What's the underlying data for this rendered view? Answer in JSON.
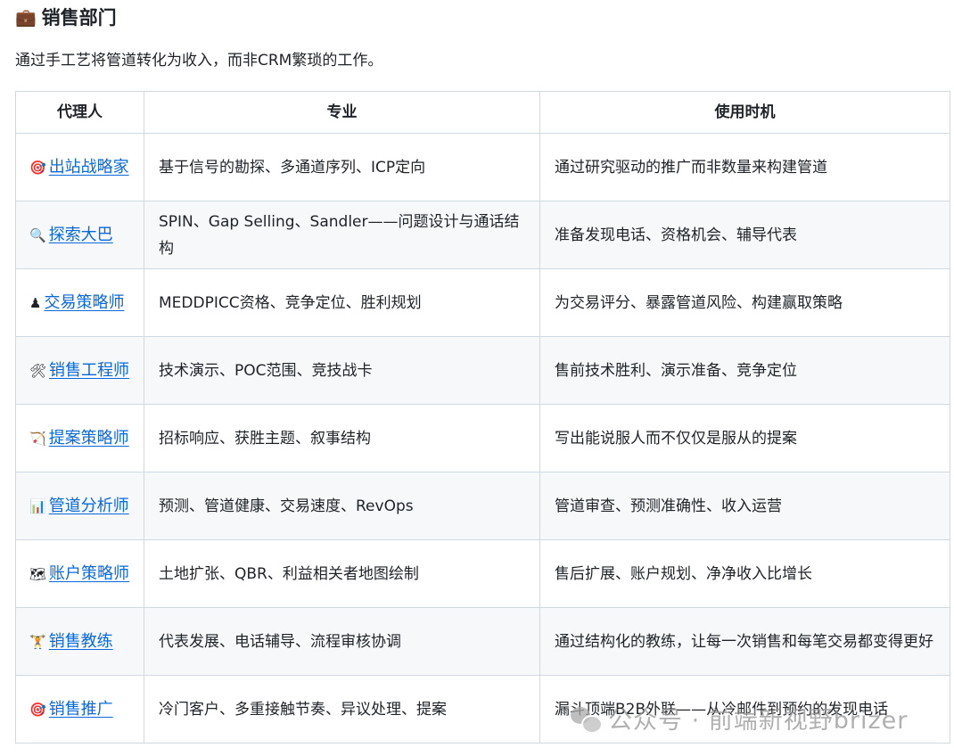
{
  "section": {
    "emoji": "💼",
    "title": "销售部门",
    "description": "通过手工艺将管道转化为收入，而非CRM繁琐的工作。"
  },
  "table": {
    "headers": [
      "代理人",
      "专业",
      "使用时机"
    ],
    "rows": [
      {
        "emoji": "🎯",
        "icon": "target-icon",
        "agent": "出站战略家",
        "expertise": "基于信号的勘探、多通道序列、ICP定向",
        "when": "通过研究驱动的推广而非数量来构建管道"
      },
      {
        "emoji": "🔍",
        "icon": "magnifier-icon",
        "agent": "探索大巴",
        "expertise": "SPIN、Gap Selling、Sandler——问题设计与通话结构",
        "when": "准备发现电话、资格机会、辅导代表"
      },
      {
        "emoji": "♟",
        "icon": "chess-pawn-icon",
        "agent": "交易策略师",
        "expertise": "MEDDPICC资格、竞争定位、胜利规划",
        "when": "为交易评分、暴露管道风险、构建赢取策略"
      },
      {
        "emoji": "🛠",
        "icon": "tools-icon",
        "agent": "销售工程师",
        "expertise": "技术演示、POC范围、竞技战卡",
        "when": "售前技术胜利、演示准备、竞争定位"
      },
      {
        "emoji": "🏹",
        "icon": "bow-arrow-icon",
        "agent": "提案策略师",
        "expertise": "招标响应、获胜主题、叙事结构",
        "when": "写出能说服人而不仅仅是服从的提案"
      },
      {
        "emoji": "📊",
        "icon": "bar-chart-icon",
        "agent": "管道分析师",
        "expertise": "预测、管道健康、交易速度、RevOps",
        "when": "管道审查、预测准确性、收入运营"
      },
      {
        "emoji": "🗺",
        "icon": "map-icon",
        "agent": "账户策略师",
        "expertise": "土地扩张、QBR、利益相关者地图绘制",
        "when": "售后扩展、账户规划、净净收入比增长"
      },
      {
        "emoji": "🏋",
        "icon": "weightlifter-icon",
        "agent": "销售教练",
        "expertise": "代表发展、电话辅导、流程审核协调",
        "when": "通过结构化的教练，让每一次销售和每笔交易都变得更好"
      },
      {
        "emoji": "🎯",
        "icon": "target-icon",
        "agent": "销售推广",
        "expertise": "冷门客户、多重接触节奏、异议处理、提案",
        "when": "漏斗顶端B2B外联——从冷邮件到预约的发现电话"
      }
    ]
  },
  "watermark": "公众号 · 前端新视野brizer"
}
